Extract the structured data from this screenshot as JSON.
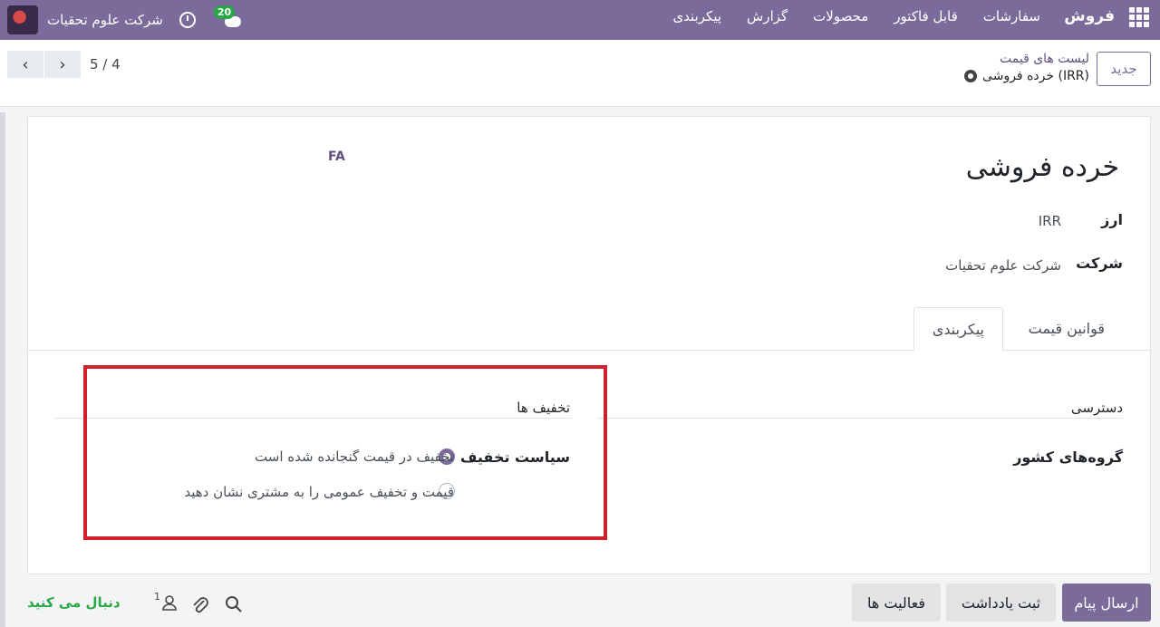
{
  "navbar": {
    "brand": "فروش",
    "menu": [
      "سفارشات",
      "قابل فاکتور",
      "محصولات",
      "گزارش",
      "پیکربندی"
    ],
    "chat_count": "20",
    "company": "شرکت علوم تحقیات"
  },
  "control_panel": {
    "new_button": "جدید",
    "breadcrumb_parent": "لیست های قیمت",
    "breadcrumb_current": "خرده فروشی (IRR)",
    "pager_value": "5 / 4",
    "prev_glyph": "‹",
    "next_glyph": "›"
  },
  "form": {
    "lang_badge": "FA",
    "title": "خرده فروشی",
    "currency_label": "ارز",
    "currency_value": "IRR",
    "company_label": "شرکت",
    "company_value": "شرکت علوم تحقیات",
    "tabs": [
      "قوانین قیمت",
      "پیکربندی"
    ],
    "access_group": "دسترسی",
    "discount_group": "تخفیف ها",
    "country_groups_label": "گروه‌های کشور",
    "discount_policy_label": "سیاست تخفیف",
    "discount_options": [
      "تخفیف در قیمت گنجانده شده است",
      "قیمت و تخفیف عمومی را به مشتری نشان دهید"
    ],
    "selected_option_index": 0
  },
  "chatter": {
    "send_message": "ارسال پیام",
    "log_note": "ثبت یادداشت",
    "activities": "فعالیت ها",
    "followers_count": "1",
    "follow_label": "دنبال می کنید"
  },
  "colors": {
    "brand": "#7b6b9b",
    "highlight": "#d0212c",
    "follow": "#28a745"
  }
}
